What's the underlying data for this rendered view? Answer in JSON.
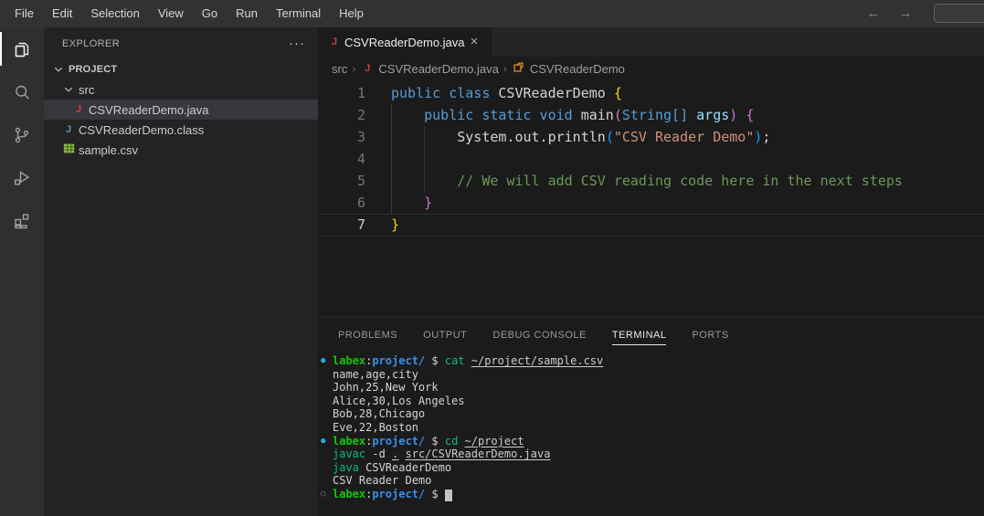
{
  "titlebar": {
    "menus": [
      "File",
      "Edit",
      "Selection",
      "View",
      "Go",
      "Run",
      "Terminal",
      "Help"
    ],
    "nav_back": "←",
    "nav_forward": "→",
    "search_value": ""
  },
  "activity_bar": {
    "items": [
      {
        "name": "explorer",
        "active": true
      },
      {
        "name": "search",
        "active": false
      },
      {
        "name": "source-control",
        "active": false
      },
      {
        "name": "run-and-debug",
        "active": false
      },
      {
        "name": "extensions",
        "active": false
      }
    ]
  },
  "sidebar": {
    "title": "EXPLORER",
    "more_label": "···",
    "tree": [
      {
        "label": "PROJECT",
        "depth": 0,
        "kind": "section",
        "expanded": true
      },
      {
        "label": "src",
        "depth": 1,
        "kind": "folder",
        "expanded": true
      },
      {
        "label": "CSVReaderDemo.java",
        "depth": 2,
        "kind": "file",
        "icon": "java-source",
        "selected": true
      },
      {
        "label": "CSVReaderDemo.class",
        "depth": 1,
        "kind": "file",
        "icon": "java-class",
        "selected": false
      },
      {
        "label": "sample.csv",
        "depth": 1,
        "kind": "file",
        "icon": "csv",
        "selected": false
      }
    ]
  },
  "editor": {
    "tab": {
      "label": "CSVReaderDemo.java",
      "icon": "java-source",
      "close_glyph": "×"
    },
    "breadcrumb": [
      {
        "label": "src",
        "icon": null
      },
      {
        "label": "CSVReaderDemo.java",
        "icon": "java-source"
      },
      {
        "label": "CSVReaderDemo",
        "icon": "class-symbol"
      }
    ],
    "breadcrumb_separator": "›",
    "code": {
      "active_line": 7,
      "lines": [
        {
          "num": 1,
          "tokens": [
            {
              "c": "kw",
              "t": "public class "
            },
            {
              "c": "plain",
              "t": "CSVReaderDemo "
            },
            {
              "c": "br-gold",
              "t": "{"
            }
          ]
        },
        {
          "num": 2,
          "tokens": [
            {
              "c": "plain",
              "t": "    "
            },
            {
              "c": "kw",
              "t": "public static void "
            },
            {
              "c": "plain",
              "t": "main"
            },
            {
              "c": "br-pink",
              "t": "("
            },
            {
              "c": "kw",
              "t": "String[] "
            },
            {
              "c": "var",
              "t": "args"
            },
            {
              "c": "br-pink",
              "t": ")"
            },
            {
              "c": "plain",
              "t": " "
            },
            {
              "c": "br-pink",
              "t": "{"
            }
          ]
        },
        {
          "num": 3,
          "tokens": [
            {
              "c": "plain",
              "t": "        System.out.println"
            },
            {
              "c": "br-blue",
              "t": "("
            },
            {
              "c": "str",
              "t": "\"CSV Reader Demo\""
            },
            {
              "c": "br-blue",
              "t": ")"
            },
            {
              "c": "plain",
              "t": ";"
            }
          ]
        },
        {
          "num": 4,
          "tokens": []
        },
        {
          "num": 5,
          "tokens": [
            {
              "c": "plain",
              "t": "        "
            },
            {
              "c": "cmt",
              "t": "// We will add CSV reading code here in the next steps"
            }
          ]
        },
        {
          "num": 6,
          "tokens": [
            {
              "c": "plain",
              "t": "    "
            },
            {
              "c": "br-pink",
              "t": "}"
            }
          ]
        },
        {
          "num": 7,
          "tokens": [
            {
              "c": "br-gold",
              "t": "}"
            }
          ]
        }
      ]
    }
  },
  "panel": {
    "tabs": [
      {
        "label": "PROBLEMS",
        "active": false
      },
      {
        "label": "OUTPUT",
        "active": false
      },
      {
        "label": "DEBUG CONSOLE",
        "active": false
      },
      {
        "label": "TERMINAL",
        "active": true
      },
      {
        "label": "PORTS",
        "active": false
      }
    ],
    "terminal": {
      "lines": [
        {
          "marker": "filled",
          "tokens": [
            {
              "c": "user",
              "t": "labex"
            },
            {
              "c": "plain",
              "t": ":"
            },
            {
              "c": "path",
              "t": "project/"
            },
            {
              "c": "plain",
              "t": " $ "
            },
            {
              "c": "cmd",
              "t": "cat"
            },
            {
              "c": "plain",
              "t": " "
            },
            {
              "c": "link",
              "t": "~/project/sample.csv"
            }
          ]
        },
        {
          "marker": null,
          "tokens": [
            {
              "c": "plain",
              "t": "name,age,city"
            }
          ]
        },
        {
          "marker": null,
          "tokens": [
            {
              "c": "plain",
              "t": "John,25,New York"
            }
          ]
        },
        {
          "marker": null,
          "tokens": [
            {
              "c": "plain",
              "t": "Alice,30,Los Angeles"
            }
          ]
        },
        {
          "marker": null,
          "tokens": [
            {
              "c": "plain",
              "t": "Bob,28,Chicago"
            }
          ]
        },
        {
          "marker": null,
          "tokens": [
            {
              "c": "plain",
              "t": "Eve,22,Boston"
            }
          ]
        },
        {
          "marker": "filled",
          "tokens": [
            {
              "c": "user",
              "t": "labex"
            },
            {
              "c": "plain",
              "t": ":"
            },
            {
              "c": "path",
              "t": "project/"
            },
            {
              "c": "plain",
              "t": " $ "
            },
            {
              "c": "cmd",
              "t": "cd"
            },
            {
              "c": "plain",
              "t": " "
            },
            {
              "c": "link",
              "t": "~/project"
            }
          ]
        },
        {
          "marker": null,
          "tokens": [
            {
              "c": "cmd",
              "t": "javac"
            },
            {
              "c": "plain",
              "t": " -d "
            },
            {
              "c": "link",
              "t": "."
            },
            {
              "c": "plain",
              "t": " "
            },
            {
              "c": "link",
              "t": "src/CSVReaderDemo.java"
            }
          ]
        },
        {
          "marker": null,
          "tokens": [
            {
              "c": "cmd",
              "t": "java"
            },
            {
              "c": "plain",
              "t": " CSVReaderDemo"
            }
          ]
        },
        {
          "marker": null,
          "tokens": [
            {
              "c": "plain",
              "t": "CSV Reader Demo"
            }
          ]
        },
        {
          "marker": "open",
          "tokens": [
            {
              "c": "user",
              "t": "labex"
            },
            {
              "c": "plain",
              "t": ":"
            },
            {
              "c": "path",
              "t": "project/"
            },
            {
              "c": "plain",
              "t": " $ "
            },
            {
              "c": "cursor",
              "t": " "
            }
          ]
        }
      ]
    }
  },
  "colors": {
    "titlebar_bg": "#323233",
    "activitybar_bg": "#2f2f30",
    "sidebar_bg": "#232323",
    "editor_bg": "#1b1b1b",
    "selection_row": "#37373d",
    "keyword": "#569cd6",
    "string": "#ce9178",
    "comment": "#6a9955",
    "bracket_gold": "#ffd700",
    "bracket_pink": "#d670d6",
    "bracket_blue": "#179fff",
    "terminal_user_green": "#16c60c",
    "terminal_path_blue": "#3b8eea",
    "terminal_cmd_green": "#0dbc79",
    "prompt_marker_blue": "#2aa9d2",
    "java_file_red": "#cc3e44",
    "class_file_blue": "#519aba",
    "csv_green": "#8dc149",
    "class_symbol_orange": "#ee9d28"
  }
}
